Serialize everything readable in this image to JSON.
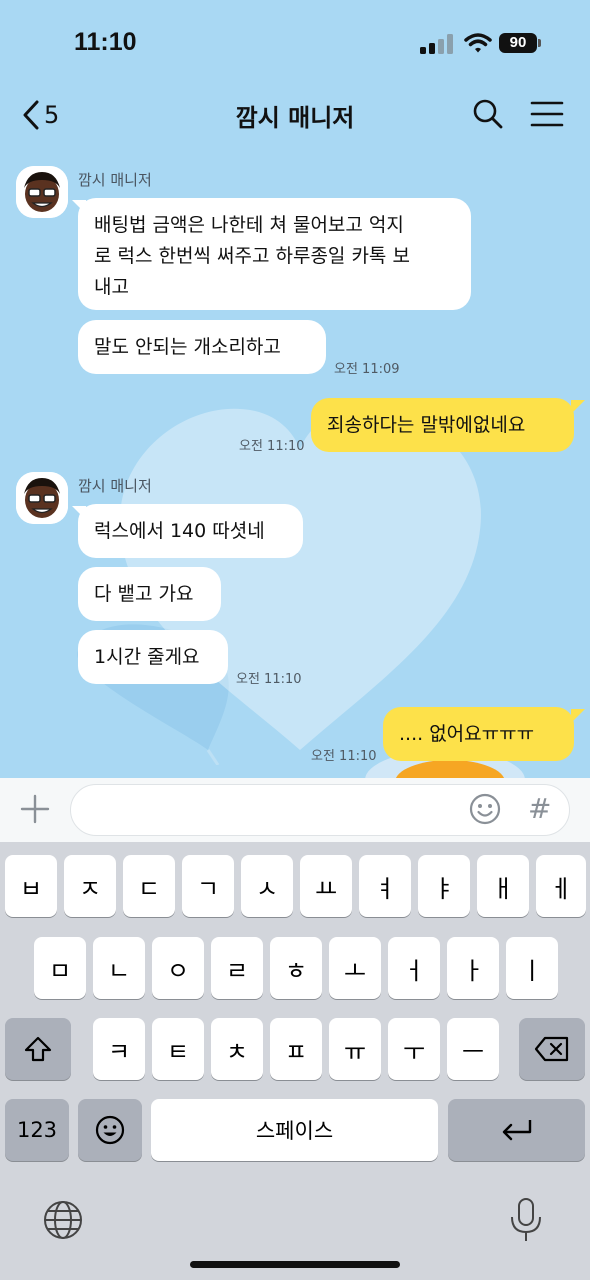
{
  "status_bar": {
    "time": "11:10",
    "battery": "90"
  },
  "header": {
    "back_count": "5",
    "title": "깜시 매니저"
  },
  "messages": [
    {
      "sender": "깜시 매니저",
      "text_lines": [
        "배팅법 금액은 나한테 쳐 물어보고 억지",
        "로 럭스 한번씩 써주고 하루종일 카톡 보",
        "내고"
      ]
    },
    {
      "text": "말도 안되는 개소리하고",
      "time": "오전 11:09"
    },
    {
      "text": "죄송하다는 말밖에없네요",
      "time": "오전 11:10",
      "mine": true
    },
    {
      "sender": "깜시 매니저",
      "text": "럭스에서 140 따셧네"
    },
    {
      "text": "다 뱉고 가요"
    },
    {
      "text": "1시간 줄게요",
      "time": "오전 11:10"
    },
    {
      "text": ".... 없어요ㅠㅠㅠ",
      "time": "오전 11:10",
      "mine": true
    }
  ],
  "input": {
    "plus_icon": "plus-icon",
    "emoji_icon": "emoji-icon",
    "hash": "#"
  },
  "keyboard": {
    "row1": [
      "ㅂ",
      "ㅈ",
      "ㄷ",
      "ㄱ",
      "ㅅ",
      "ㅛ",
      "ㅕ",
      "ㅑ",
      "ㅐ",
      "ㅔ"
    ],
    "row2": [
      "ㅁ",
      "ㄴ",
      "ㅇ",
      "ㄹ",
      "ㅎ",
      "ㅗ",
      "ㅓ",
      "ㅏ",
      "ㅣ"
    ],
    "row3": [
      "ㅋ",
      "ㅌ",
      "ㅊ",
      "ㅍ",
      "ㅠ",
      "ㅜ",
      "ㅡ"
    ],
    "numbers": "123",
    "space": "스페이스"
  }
}
